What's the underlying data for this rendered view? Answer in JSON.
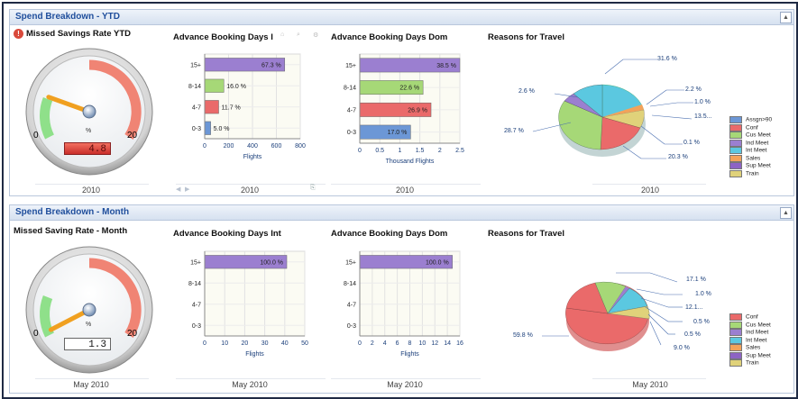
{
  "ytd": {
    "header": "Spend Breakdown - YTD",
    "gauge": {
      "title": "Missed Savings Rate YTD",
      "value": "4.8",
      "min": "0",
      "max": "20",
      "unit": "%",
      "level": 4.8,
      "footer": "2010"
    },
    "int": {
      "title": "Advance Booking Days I",
      "footer": "2010",
      "chart_data": {
        "type": "bar",
        "categories": [
          "15+",
          "8-14",
          "4-7",
          "0-3"
        ],
        "values": [
          67.3,
          16.0,
          11.7,
          5.0
        ],
        "value_scale": [
          670,
          160,
          117,
          50
        ],
        "labels": [
          "67.3 %",
          "16.0 %",
          "11.7 %",
          "5.0 %"
        ],
        "colors": [
          "#9b7fd0",
          "#a6d877",
          "#ea6a6a",
          "#6c97d6"
        ],
        "xticks": [
          "0",
          "200",
          "400",
          "600",
          "800"
        ],
        "xlim": [
          0,
          800
        ],
        "xlabel": "Flights"
      }
    },
    "dom": {
      "title": "Advance Booking Days Dom",
      "footer": "2010",
      "chart_data": {
        "type": "bar",
        "categories": [
          "15+",
          "8-14",
          "4-7",
          "0-3"
        ],
        "values": [
          38.5,
          22.6,
          26.9,
          17.0
        ],
        "value_scale": [
          2.5,
          1.58,
          1.78,
          1.27
        ],
        "labels": [
          "38.5 %",
          "22.6 %",
          "26.9 %",
          "17.0 %"
        ],
        "colors": [
          "#9b7fd0",
          "#a6d877",
          "#ea6a6a",
          "#6c97d6"
        ],
        "xticks": [
          "0",
          "0.5",
          "1",
          "1.5",
          "2",
          "2.5"
        ],
        "xlim": [
          0,
          2.5
        ],
        "xlabel": "Thousand Flights"
      }
    },
    "reasons": {
      "title": "Reasons for Travel",
      "footer": "2010",
      "labels": [
        "31.6 %",
        "2.2 %",
        "1.0 %",
        "13.5...",
        "0.1 %",
        "20.3 %",
        "28.7 %",
        "2.6 %"
      ],
      "legend": [
        "Assgn>90",
        "Conf",
        "Cus Meet",
        "Ind Meet",
        "Int Meet",
        "Sales",
        "Sup Meet",
        "Train"
      ],
      "legend_colors": [
        "#6c97d6",
        "#ea6a6a",
        "#a6d877",
        "#9b7fd0",
        "#5bc8e0",
        "#f2a35a",
        "#8d63c4",
        "#e0d27a"
      ]
    }
  },
  "month": {
    "header": "Spend Breakdown - Month",
    "gauge": {
      "title": "Missed Saving Rate - Month",
      "value": "1.3",
      "min": "0",
      "max": "20",
      "unit": "%",
      "level": 1.3,
      "footer": "May 2010"
    },
    "int": {
      "title": "Advance Booking Days Int",
      "footer": "May 2010",
      "chart_data": {
        "type": "bar",
        "categories": [
          "15+",
          "8-14",
          "4-7",
          "0-3"
        ],
        "values": [
          100.0,
          0,
          0,
          0
        ],
        "value_scale": [
          41,
          0,
          0,
          0
        ],
        "labels": [
          "100.0 %",
          "",
          "",
          ""
        ],
        "colors": [
          "#9b7fd0",
          "#a6d877",
          "#ea6a6a",
          "#6c97d6"
        ],
        "xticks": [
          "0",
          "10",
          "20",
          "30",
          "40",
          "50"
        ],
        "xlim": [
          0,
          50
        ],
        "xlabel": "Flights"
      }
    },
    "dom": {
      "title": "Advance Booking Days Dom",
      "footer": "May 2010",
      "chart_data": {
        "type": "bar",
        "categories": [
          "15+",
          "8-14",
          "4-7",
          "0-3"
        ],
        "values": [
          100.0,
          0,
          0,
          0
        ],
        "value_scale": [
          14.8,
          0,
          0,
          0
        ],
        "labels": [
          "100.0 %",
          "",
          "",
          ""
        ],
        "colors": [
          "#9b7fd0",
          "#a6d877",
          "#ea6a6a",
          "#6c97d6"
        ],
        "xticks": [
          "0",
          "2",
          "4",
          "6",
          "8",
          "10",
          "12",
          "14",
          "16"
        ],
        "xlim": [
          0,
          16
        ],
        "xlabel": "Flights"
      }
    },
    "reasons": {
      "title": "Reasons for Travel",
      "footer": "May 2010",
      "labels": [
        "17.1 %",
        "1.0 %",
        "12.1...",
        "0.5 %",
        "0.5 %",
        "9.0 %",
        "59.8 %"
      ],
      "legend": [
        "Conf",
        "Cus Meet",
        "Ind Meet",
        "Int Meet",
        "Sales",
        "Sup Meet",
        "Train"
      ],
      "legend_colors": [
        "#ea6a6a",
        "#a6d877",
        "#9b7fd0",
        "#5bc8e0",
        "#f2a35a",
        "#8d63c4",
        "#e0d27a"
      ]
    }
  }
}
